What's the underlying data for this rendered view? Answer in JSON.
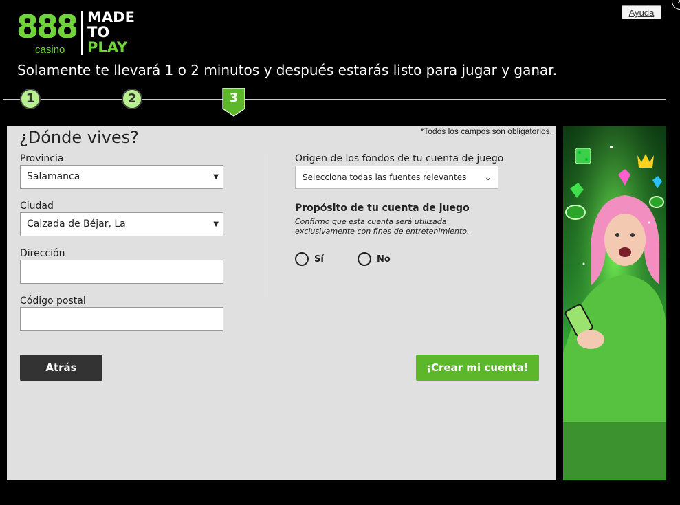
{
  "header": {
    "logo_number": "888",
    "logo_casino": "casino",
    "logo_made": "MADE",
    "logo_to": "TO",
    "logo_play": "PLAY",
    "help_label": "Ayuda",
    "subtitle": "Solamente te llevará 1 o 2 minutos y después estarás listo para jugar y ganar."
  },
  "steps": [
    {
      "label": "1",
      "state": "completed"
    },
    {
      "label": "2",
      "state": "completed"
    },
    {
      "label": "3",
      "state": "active"
    }
  ],
  "form": {
    "title": "¿Dónde vives?",
    "required_note": "*Todos los campos son obligatorios.",
    "province": {
      "label": "Provincia",
      "value": "Salamanca"
    },
    "city": {
      "label": "Ciudad",
      "value": "Calzada de Béjar, La"
    },
    "address": {
      "label": "Dirección",
      "value": ""
    },
    "postal_code": {
      "label": "Código postal",
      "value": ""
    },
    "funds_origin": {
      "label": "Origen de los fondos de tu cuenta de juego",
      "value": "Selecciona todas las fuentes relevantes"
    },
    "purpose": {
      "title": "Propósito de tu cuenta de juego",
      "description": "Confirmo que esta cuenta será utilizada exclusivamente con fines de entretenimiento.",
      "options": [
        "Sí",
        "No"
      ]
    },
    "back_label": "Atrás",
    "create_label": "¡Crear mi cuenta!"
  },
  "colors": {
    "brand_green": "#6fd33a",
    "step_completed": "#b8f08f",
    "step_active": "#5cb82a",
    "create_button": "#5cb82a",
    "back_button": "#333333",
    "panel_bg": "#e0e0e0"
  }
}
